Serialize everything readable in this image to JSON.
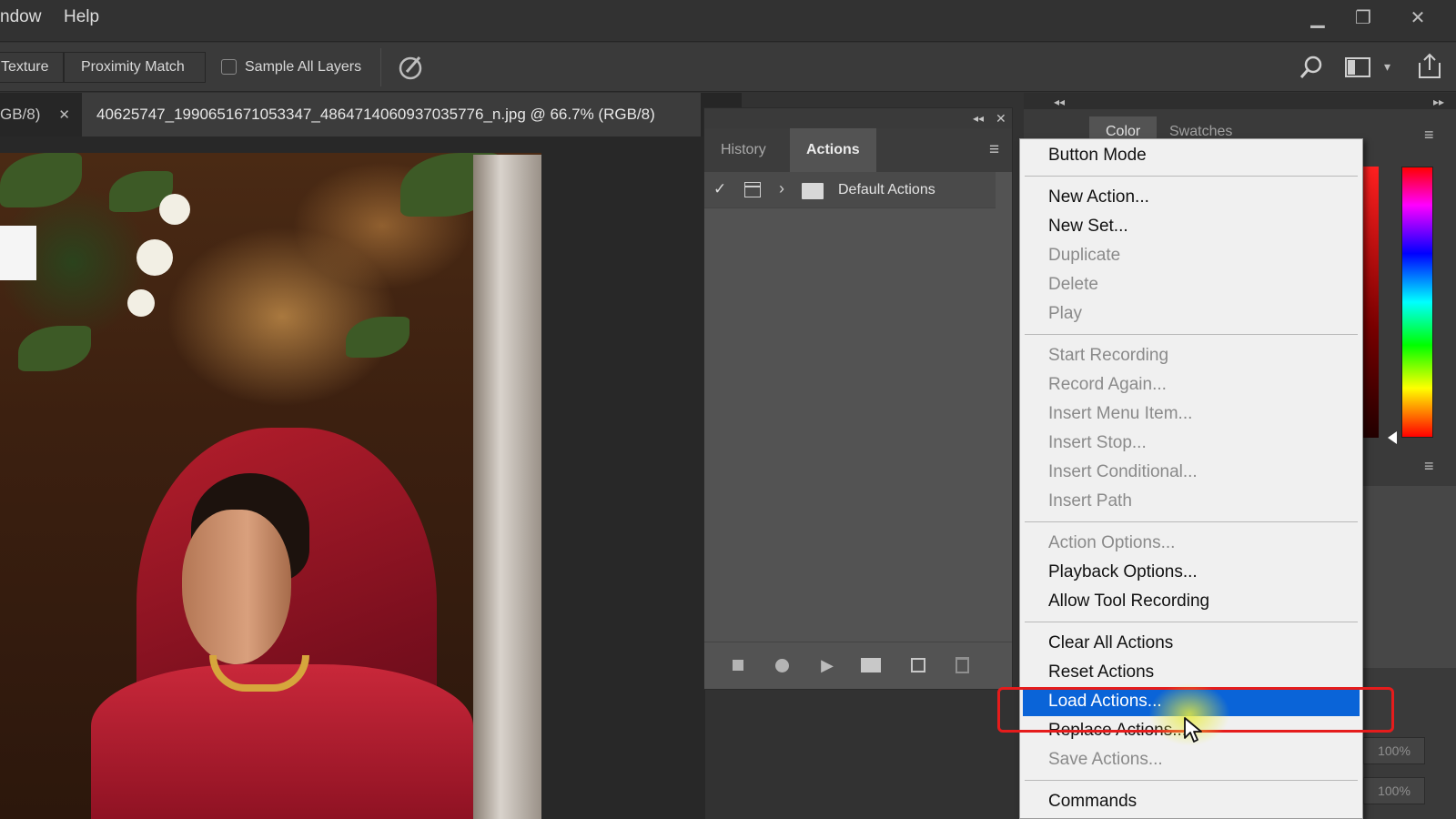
{
  "menubar": {
    "items": [
      "ndow",
      "Help"
    ]
  },
  "options": {
    "texture_label": "Texture",
    "proximity_label": "Proximity Match",
    "sample_all_layers_label": "Sample All Layers",
    "sample_all_layers_checked": false
  },
  "doc_tabs": {
    "prev_tab": "GB/8)",
    "active_tab": "40625747_1990651671053347_4864714060937035776_n.jpg @ 66.7% (RGB/8)"
  },
  "actions_panel": {
    "tabs": [
      "History",
      "Actions"
    ],
    "active_tab": "Actions",
    "set_name": "Default Actions"
  },
  "right_panel": {
    "tabs": [
      "Color",
      "Swatches"
    ],
    "zoom_values": [
      "100%",
      "100%"
    ]
  },
  "context_menu": {
    "groups": [
      [
        {
          "label": "Button Mode",
          "enabled": true
        }
      ],
      [
        {
          "label": "New Action...",
          "enabled": true
        },
        {
          "label": "New Set...",
          "enabled": true
        },
        {
          "label": "Duplicate",
          "enabled": false
        },
        {
          "label": "Delete",
          "enabled": false
        },
        {
          "label": "Play",
          "enabled": false
        }
      ],
      [
        {
          "label": "Start Recording",
          "enabled": false
        },
        {
          "label": "Record Again...",
          "enabled": false
        },
        {
          "label": "Insert Menu Item...",
          "enabled": false
        },
        {
          "label": "Insert Stop...",
          "enabled": false
        },
        {
          "label": "Insert Conditional...",
          "enabled": false
        },
        {
          "label": "Insert Path",
          "enabled": false
        }
      ],
      [
        {
          "label": "Action Options...",
          "enabled": false
        },
        {
          "label": "Playback Options...",
          "enabled": true
        },
        {
          "label": "Allow Tool Recording",
          "enabled": true
        }
      ],
      [
        {
          "label": "Clear All Actions",
          "enabled": true
        },
        {
          "label": "Reset Actions",
          "enabled": true
        },
        {
          "label": "Load Actions...",
          "enabled": true,
          "highlighted": true
        },
        {
          "label": "Replace Actions...",
          "enabled": true
        },
        {
          "label": "Save Actions...",
          "enabled": false
        }
      ],
      [
        {
          "label": "Commands",
          "enabled": true
        }
      ]
    ]
  },
  "colors": {
    "highlight": "#0a64d8",
    "annotation": "#e51c1c"
  }
}
